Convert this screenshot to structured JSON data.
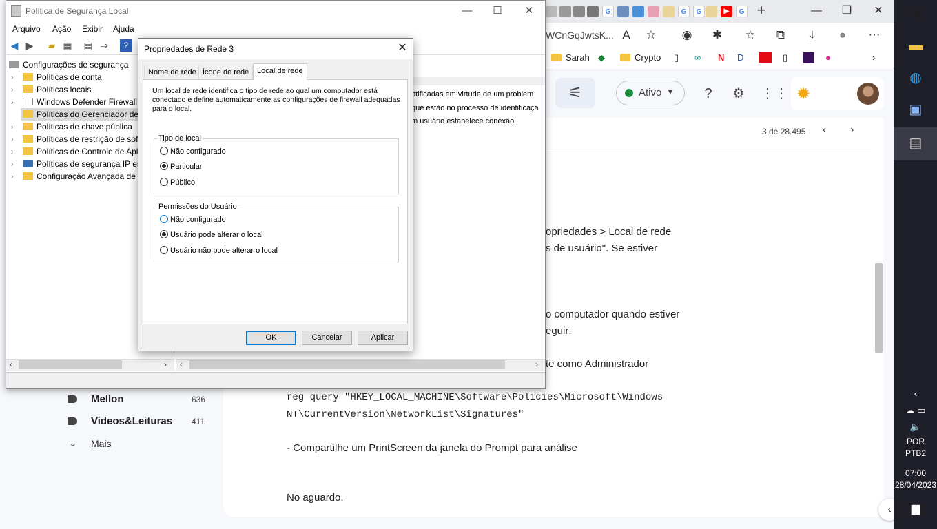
{
  "browser": {
    "address_fragment": "WCnGqJwtsK...",
    "bookmarks": [
      "Sarah",
      "Crypto"
    ],
    "status": {
      "label": "Ativo",
      "dot_color": "#1e8e3e"
    },
    "counter": "3 de 28.495",
    "labels": [
      {
        "name": "Mellon",
        "count": "636"
      },
      {
        "name": "Videos&Leituras",
        "count": "411"
      }
    ],
    "more_label": "Mais",
    "mail_lines": {
      "l1": "opriedades > Local de rede",
      "l2": "s de usuário\". Se estiver",
      "l3": "o computador quando estiver",
      "l4": "eguir:",
      "l5": "te como Administrador",
      "cmd1": "reg query \"HKEY_LOCAL_MACHINE\\Software\\Policies\\Microsoft\\Windows",
      "cmd2": "NT\\CurrentVersion\\NetworkList\\Signatures\"",
      "l6": "- Compartilhe um PrintScreen da janela do Prompt para análise",
      "l7": "No aguardo."
    }
  },
  "taskbar": {
    "lang1": "POR",
    "lang2": "PTB2",
    "time": "07:00",
    "date": "28/04/2023"
  },
  "mmc": {
    "title": "Política de Segurança Local",
    "menu": [
      "Arquivo",
      "Ação",
      "Exibir",
      "Ajuda"
    ],
    "tree_root": "Configurações de segurança",
    "tree": [
      "Políticas de conta",
      "Políticas locais",
      "Windows Defender Firewall com Segurança Avançada",
      "Políticas do Gerenciador de Listas de Redes",
      "Políticas de chave pública",
      "Políticas de restrição de software",
      "Políticas de Controle de Aplicativo",
      "Políticas de segurança IP em Computador Local",
      "Configuração Avançada de Política de Auditoria"
    ],
    "desc": [
      "ntificadas em virtude de um problem",
      "que estão no processo de identificaçã",
      "m usuário estabelece conexão."
    ]
  },
  "dialog": {
    "title": "Propriedades de Rede 3",
    "tabs": [
      "Nome de rede",
      "Ícone de rede",
      "Local de rede"
    ],
    "intro": "Um local de rede identifica o tipo de rede ao qual um computador está conectado e define automaticamente as configurações de firewall adequadas para o local.",
    "group1": {
      "label": "Tipo de local",
      "options": [
        "Não configurado",
        "Particular",
        "Público"
      ],
      "selected": 1
    },
    "group2": {
      "label": "Permissões do Usuário",
      "options": [
        "Não configurado",
        "Usuário pode alterar o local",
        "Usuário não pode alterar o local"
      ],
      "selected": 1
    },
    "buttons": {
      "ok": "OK",
      "cancel": "Cancelar",
      "apply": "Aplicar"
    }
  }
}
